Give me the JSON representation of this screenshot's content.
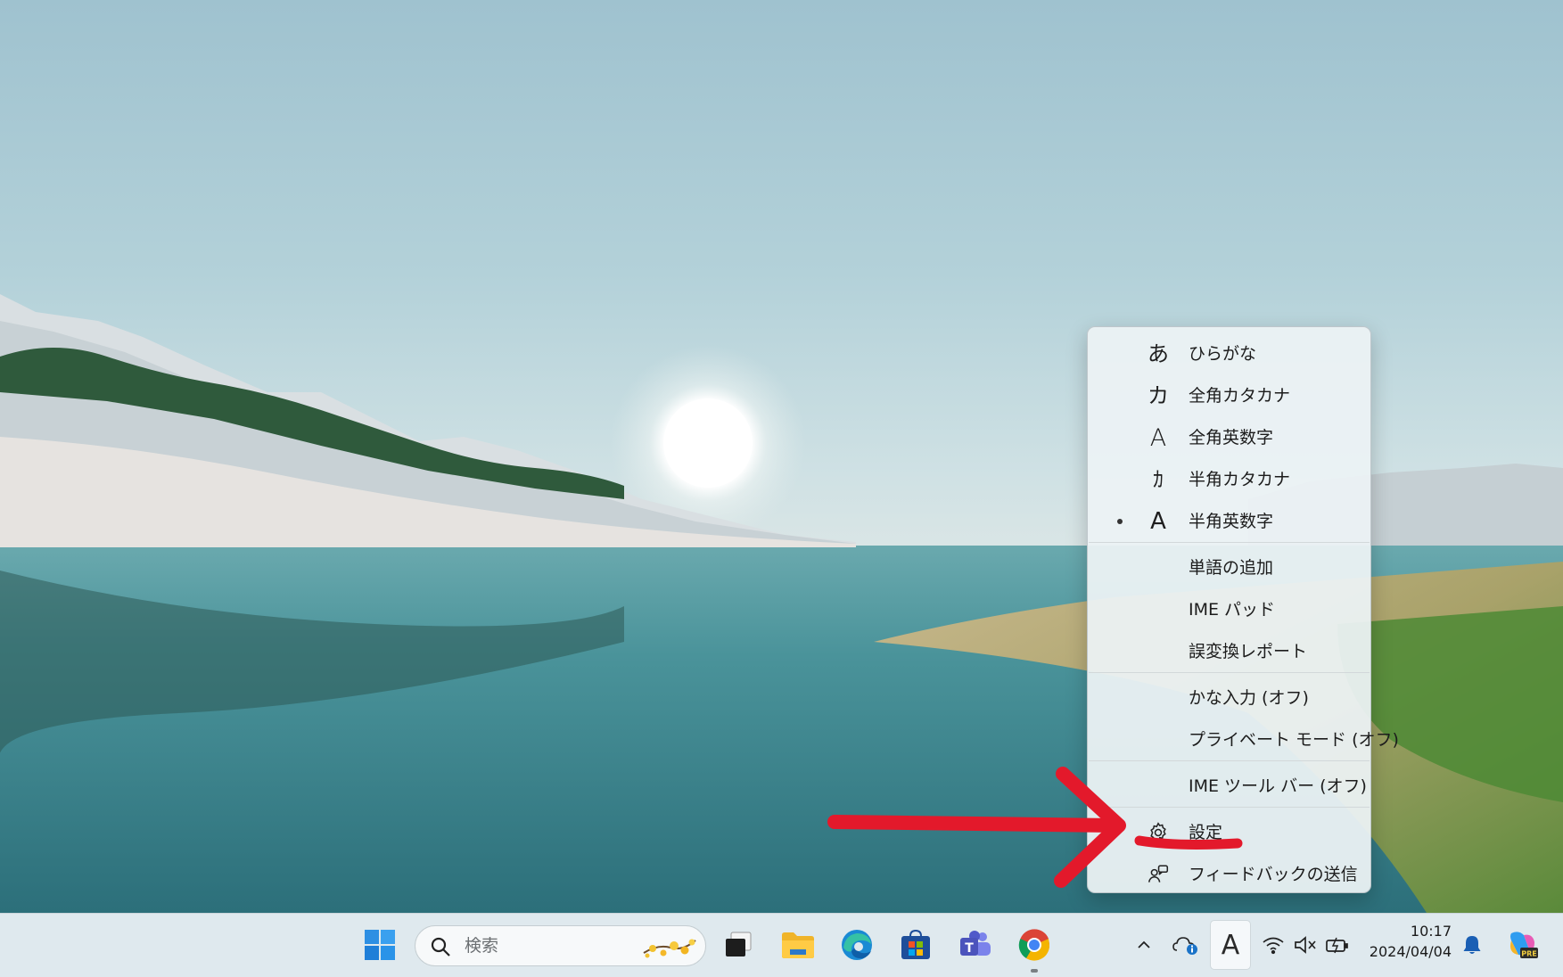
{
  "ime_menu": {
    "items": [
      {
        "glyph": "あ",
        "label": "ひらがな",
        "selected": false
      },
      {
        "glyph": "カ",
        "label": "全角カタカナ",
        "selected": false
      },
      {
        "glyph": "A",
        "label": "全角英数字",
        "selected": false
      },
      {
        "glyph": "ｶ",
        "label": "半角カタカナ",
        "selected": false
      },
      {
        "glyph": "A",
        "label": "半角英数字",
        "selected": true
      }
    ],
    "tools": [
      {
        "label": "単語の追加"
      },
      {
        "label": "IME パッド"
      },
      {
        "label": "誤変換レポート"
      }
    ],
    "toggles": [
      {
        "label": "かな入力 (オフ)"
      },
      {
        "label": "プライベート モード (オフ)"
      }
    ],
    "toolbar_item": {
      "label": "IME ツール バー (オフ)"
    },
    "settings": {
      "label": "設定",
      "icon": "gear-icon"
    },
    "feedback": {
      "label": "フィードバックの送信",
      "icon": "feedback-icon"
    }
  },
  "taskbar": {
    "search_placeholder": "検索",
    "pinned_apps": [
      "start",
      "task-view",
      "file-explorer",
      "edge",
      "microsoft-store",
      "teams",
      "chrome"
    ],
    "ime_indicator": "A",
    "clock": {
      "time": "10:17",
      "date": "2024/04/04"
    }
  },
  "annotation": {
    "color": "#e3192b"
  }
}
